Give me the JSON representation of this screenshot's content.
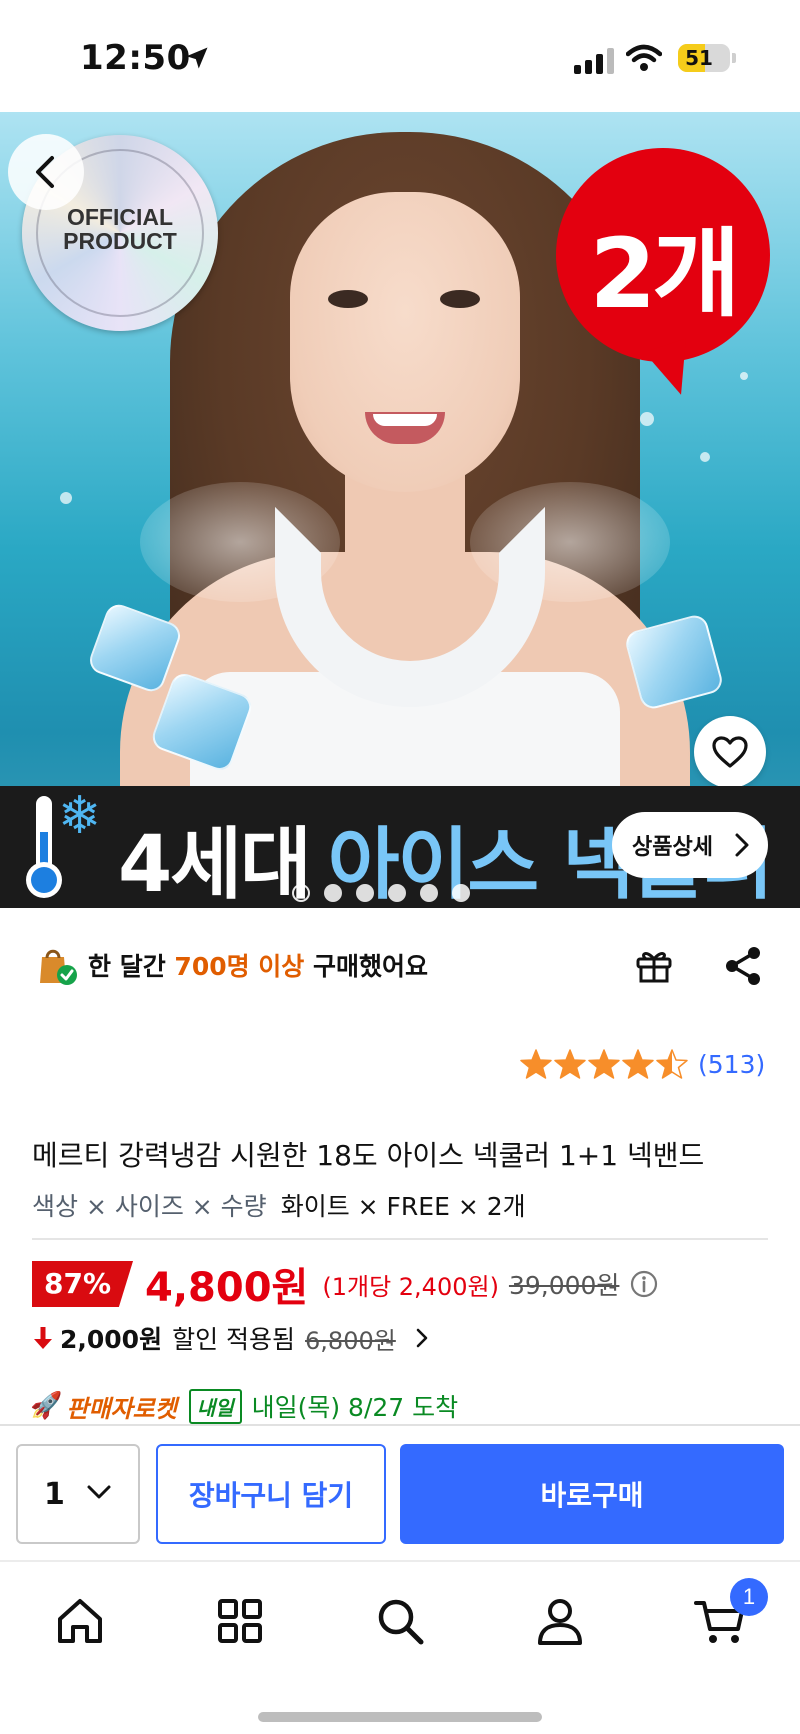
{
  "status_bar": {
    "time": "12:50",
    "battery": "51",
    "battery_level": 0.51
  },
  "hero": {
    "official_line1": "OFFICIAL",
    "official_line2": "PRODUCT",
    "count_badge": "2개",
    "banner_title_white": "4세대",
    "banner_title_blue": "아이스 넥쿨러",
    "detail_button": "상품상세",
    "carousel": {
      "total": 6,
      "active_index": 0
    }
  },
  "purchase_notice": {
    "prefix": "한 달간 ",
    "highlight": "700명 이상",
    "suffix": " 구매했어요"
  },
  "rating": {
    "stars": 4.5,
    "count": "(513)"
  },
  "product": {
    "title": "메르티 강력냉감 시원한 18도 아이스 넥쿨러 1+1 넥밴드",
    "option_keys": "색상 × 사이즈 × 수량",
    "option_values": "화이트 × FREE × 2개"
  },
  "price": {
    "discount": "87%",
    "current": "4,800원",
    "per_unit": "(1개당 2,400원)",
    "original": "39,000원"
  },
  "coupon": {
    "amount": "2,000원",
    "label": "할인 적용됨",
    "old_price": "6,800원"
  },
  "delivery": {
    "seller": "판매자로켓",
    "badge": "내일",
    "arrival": "내일(목) 8/27 도착"
  },
  "actions": {
    "quantity": "1",
    "add_to_cart": "장바구니 담기",
    "buy_now": "바로구매"
  },
  "bottom_nav": {
    "cart_count": "1"
  },
  "colors": {
    "accent_blue": "#346aff",
    "price_red": "#e3000f",
    "orange": "#e05d00",
    "green": "#0a8a23"
  }
}
